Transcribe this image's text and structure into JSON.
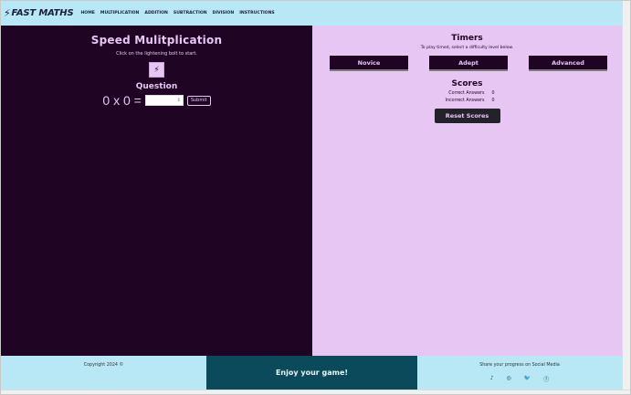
{
  "nav": {
    "brand_bolt": "⚡",
    "brand": "FAST MATHS",
    "items": [
      "HOME",
      "MULTIPLICATION",
      "ADDITION",
      "SUBTRACTION",
      "DIVISION",
      "INSTRUCTIONS"
    ]
  },
  "game": {
    "title": "Speed Mulitplication",
    "hint": "Click on the lightening bolt to start.",
    "bolt_icon": "⚡",
    "question_heading": "Question",
    "question_text": "0 x 0 =",
    "answer_value": "",
    "spin_icon": "⇕",
    "submit_label": "Submit"
  },
  "timers": {
    "title": "Timers",
    "hint": "To play timed, select a difficulty level below.",
    "levels": [
      "Novice",
      "Adept",
      "Advanced"
    ]
  },
  "scores": {
    "title": "Scores",
    "correct_label": "Correct Answers",
    "correct_value": "0",
    "incorrect_label": "Incorrect Answers",
    "incorrect_value": "0",
    "reset_label": "Reset Scores"
  },
  "footer": {
    "copyright": "Copyright 2024 ©",
    "center": "Enjoy your game!",
    "share": "Share your progress on Social Media",
    "social_icons": [
      "♪",
      "◎",
      "🐦",
      "ⓕ"
    ]
  },
  "colors": {
    "nav_bg": "#b8e7f5",
    "left_bg": "#1f0424",
    "right_bg": "#e7c6f3",
    "accent_dark": "#0a4a5a"
  }
}
